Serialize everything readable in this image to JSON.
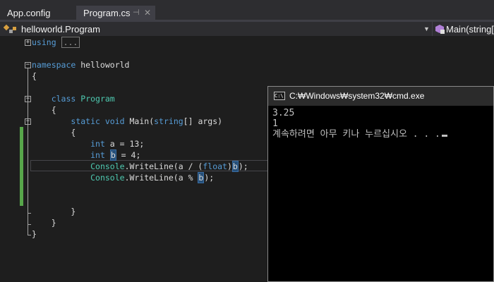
{
  "tabs": [
    {
      "label": "App.config"
    },
    {
      "label": "Program.cs",
      "pin_icon": "pin-icon",
      "close_icon": "close-icon"
    }
  ],
  "navbar": {
    "left": "helloworld.Program",
    "right": "Main(string[]"
  },
  "code": {
    "l1_kw": "using",
    "l1_collapsed": "...",
    "l3_kw": "namespace",
    "l3_rest": " helloworld",
    "l4": "{",
    "l6_kw": "class",
    "l6_sp": " ",
    "l6_type": "Program",
    "l7": "{",
    "l8_kw1": "static",
    "l8_sp1": " ",
    "l8_kw2": "void",
    "l8_mid": " Main(",
    "l8_kw3": "string",
    "l8_rest": "[] args)",
    "l9": "{",
    "l10_kw": "int",
    "l10_rest": " a = 13;",
    "l11_kw": "int",
    "l11_sp": " ",
    "l11_var": "b",
    "l11_rest": " = 4;",
    "l12_type": "Console",
    "l12_mid": ".WriteLine(a / (",
    "l12_kw": "float",
    "l12_cp": ")",
    "l12_var": "b",
    "l12_end": ");",
    "l13_type": "Console",
    "l13_mid": ".WriteLine(a % ",
    "l13_var": "b",
    "l13_end": ");",
    "l16": "}",
    "l17": "}",
    "l18": "}"
  },
  "console": {
    "title": "C:₩Windows₩system32₩cmd.exe",
    "lines": [
      "3.25",
      "1",
      "계속하려면 아무 키나 누르십시오 . . ."
    ]
  },
  "colors": {
    "change_bar": "#57a64a",
    "keyword": "#569cd6",
    "type": "#4ec9b0"
  }
}
